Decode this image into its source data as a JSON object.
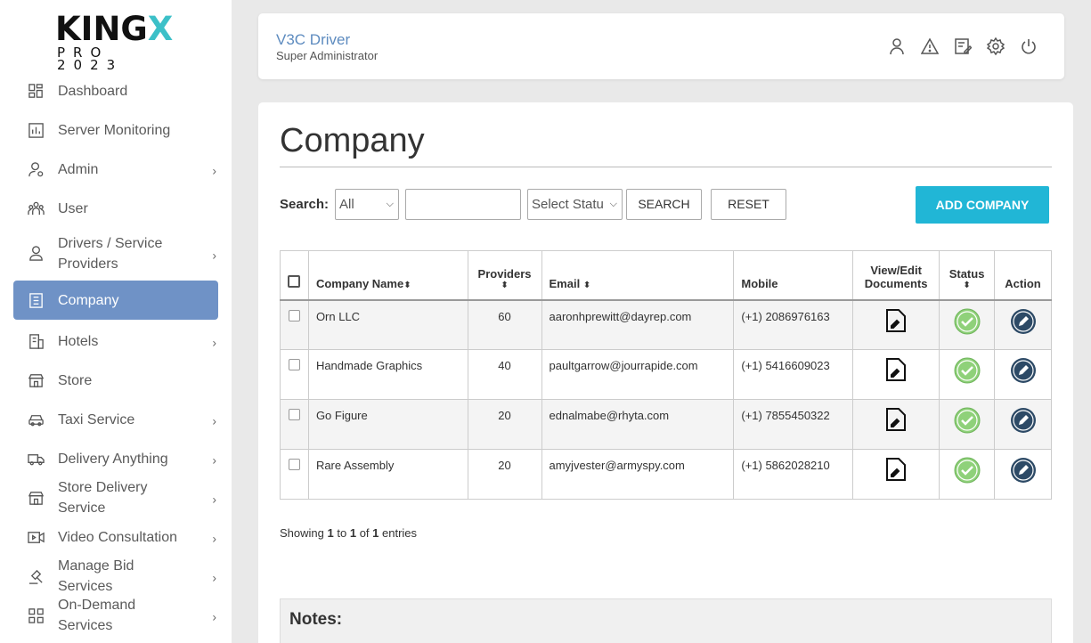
{
  "brand": {
    "main_prefix": "KING",
    "main_x": "X",
    "sub": "PRO 2023",
    "accent": "#3cc0c8"
  },
  "sidebar": {
    "items": [
      {
        "label": "Dashboard",
        "icon": "dashboard-icon",
        "expand": ""
      },
      {
        "label": "Server Monitoring",
        "icon": "chart-icon",
        "expand": ""
      },
      {
        "label": "Admin",
        "icon": "admin-icon",
        "expand": "›"
      },
      {
        "label": "User",
        "icon": "users-icon",
        "expand": ""
      },
      {
        "label": "Drivers / Service Providers",
        "icon": "driver-icon",
        "expand": "›"
      },
      {
        "label": "Company",
        "icon": "building-icon",
        "expand": ""
      },
      {
        "label": "Hotels",
        "icon": "hotel-icon",
        "expand": "›"
      },
      {
        "label": "Store",
        "icon": "store-icon",
        "expand": ""
      },
      {
        "label": "Taxi Service",
        "icon": "taxi-icon",
        "expand": "›"
      },
      {
        "label": "Delivery Anything",
        "icon": "truck-icon",
        "expand": "›"
      },
      {
        "label": "Store Delivery Service",
        "icon": "store-delivery-icon",
        "expand": "›"
      },
      {
        "label": "Video Consultation",
        "icon": "video-icon",
        "expand": "›"
      },
      {
        "label": "Manage Bid Services",
        "icon": "gavel-icon",
        "expand": "›"
      },
      {
        "label": "On-Demand Services",
        "icon": "grid-icon",
        "expand": "›"
      }
    ],
    "active_color": "#6f92c6"
  },
  "header": {
    "name": "V3C Driver",
    "role": "Super Administrator",
    "icons": [
      "user-icon",
      "warning-icon",
      "edit-note-icon",
      "settings-icon",
      "power-icon"
    ]
  },
  "main": {
    "title": "Company",
    "search": {
      "label": "Search:",
      "field_select": "All",
      "status_select": "Select Statu",
      "query": "",
      "search_button": "SEARCH",
      "reset_button": "RESET"
    },
    "add_button": "ADD COMPANY",
    "table": {
      "headers": {
        "name": "Company Name",
        "providers": "Providers",
        "email": "Email",
        "mobile": "Mobile",
        "docs_line1": "View/Edit",
        "docs_line2": "Documents",
        "status": "Status",
        "action": "Action",
        "sort_glyph": "⬍"
      },
      "rows": [
        {
          "name": "Orn LLC",
          "providers": "60",
          "email": "aaronhprewitt@dayrep.com",
          "mobile": "(+1) 2086976163"
        },
        {
          "name": "Handmade Graphics",
          "providers": "40",
          "email": "paultgarrow@jourrapide.com",
          "mobile": "(+1) 5416609023"
        },
        {
          "name": "Go Figure",
          "providers": "20",
          "email": "ednalmabe@rhyta.com",
          "mobile": "(+1) 7855450322"
        },
        {
          "name": "Rare Assembly",
          "providers": "20",
          "email": "amyjvester@armyspy.com",
          "mobile": "(+1) 5862028210"
        }
      ]
    },
    "showing": {
      "prefix": "Showing",
      "from": "1",
      "to_word": "to",
      "to": "1",
      "of_word": "of",
      "total": "1",
      "suffix": "entries"
    },
    "notes_title": "Notes:",
    "colors": {
      "add_button": "#21b6d6",
      "status_ok": "#8fd17a",
      "action": "#2d4a66",
      "link": "#3a7cc4"
    }
  }
}
